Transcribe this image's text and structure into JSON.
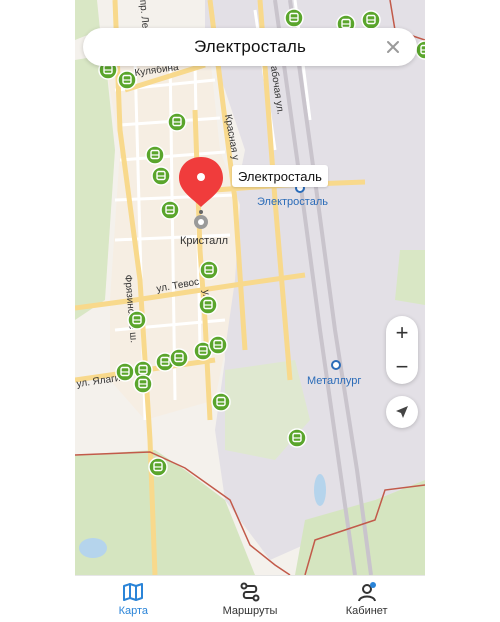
{
  "search": {
    "title": "Электросталь"
  },
  "marker": {
    "label": "Электросталь",
    "color": "#f03c3c"
  },
  "map": {
    "street_labels": {
      "kulyabina": "Кулябина",
      "krasnaya": "Красная у",
      "rabochaya": "Рабочая ул.",
      "tevos": "ул. Тевос",
      "frjazinskoe": "Фрязинское ш.",
      "yalagin": "ул. Ялаги",
      "raspl": "ула",
      "lenina": "пр. Ленина"
    },
    "poi": {
      "kristall": "Кристалл",
      "station_electrostal": "Электросталь",
      "station_metallurg": "Металлург"
    },
    "colors": {
      "bus_stop": "#5aa52c",
      "road_main": "#f8d98c",
      "railway": "#c9c4cc",
      "boundary": "#c25a4a",
      "station": "#2a6bb8"
    }
  },
  "controls": {
    "zoom_in": "+",
    "zoom_out": "−"
  },
  "nav": {
    "map": "Карта",
    "routes": "Маршруты",
    "cabinet": "Кабинет",
    "active": "map"
  }
}
